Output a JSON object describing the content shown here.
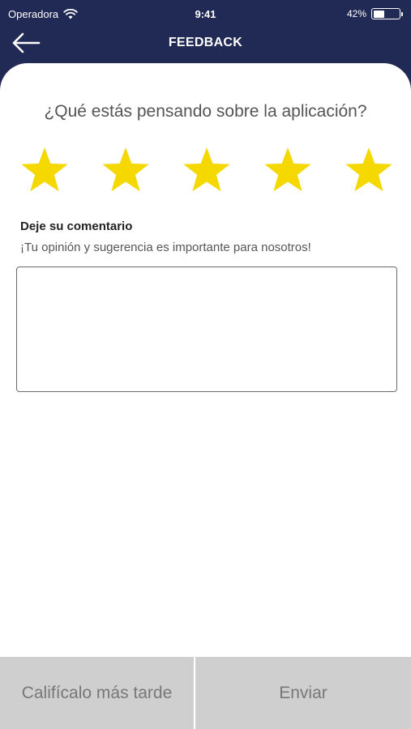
{
  "status_bar": {
    "carrier": "Operadora",
    "time": "9:41",
    "battery_percent_label": "42%",
    "battery_level": 0.42
  },
  "nav": {
    "title": "FEEDBACK",
    "back_icon": "arrow-left-icon"
  },
  "rating": {
    "question": "¿Qué estás pensando sobre la aplicación?",
    "max_stars": 5,
    "selected_stars": 5,
    "star_icon": "star-icon",
    "star_color": "#f5d800"
  },
  "comment": {
    "label": "Deje su comentario",
    "hint": "¡Tu opinión y sugerencia es importante para nosotros!",
    "value": "",
    "placeholder": ""
  },
  "actions": {
    "later_label": "Califícalo más tarde",
    "send_label": "Enviar"
  },
  "colors": {
    "header_bg": "#212a54",
    "button_bg": "#cfcfcf",
    "button_text": "#777777"
  }
}
